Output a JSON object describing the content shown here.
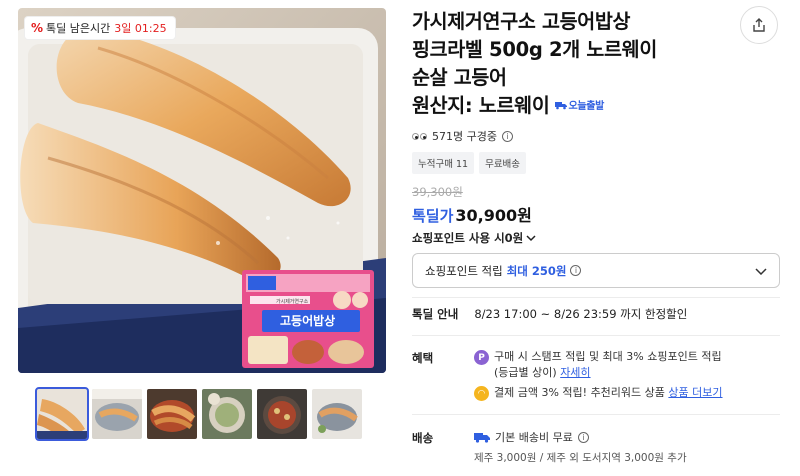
{
  "deal_badge": {
    "percent_icon": "%",
    "label": "톡딜 남은시간",
    "time": "3일 01:25"
  },
  "product": {
    "title_line1": "가시제거연구소 고등어밥상",
    "title_line2": "핑크라벨 500g 2개 노르웨이",
    "title_line3": "순살 고등어",
    "title_line4": "원산지: 노르웨이",
    "today_ship_label": "오늘출발"
  },
  "viewers": {
    "text": "571명 구경중"
  },
  "chips": [
    "누적구매 11",
    "무료배송"
  ],
  "price": {
    "original": "39,300원",
    "label": "톡딜가",
    "value": "30,900원"
  },
  "points": {
    "use_label": "쇼핑포인트 사용 시0원",
    "earn_label": "쇼핑포인트 적립",
    "earn_accent": "최대 250원"
  },
  "deal_info": {
    "key": "톡딜 안내",
    "value": "8/23 17:00 ~ 8/26 23:59 까지 한정할인"
  },
  "benefits": {
    "label": "혜택",
    "item1_line1": "구매 시 스탬프 적립 및 최대 3% 쇼핑포인트 적립",
    "item1_line2": "(등급별 상이)",
    "item1_link": "자세히",
    "item2_text": "결제 금액 3% 적립! 추천리워드 상품",
    "item2_link": "상품 더보기"
  },
  "shipping": {
    "label": "배송",
    "text": "기본 배송비 무료",
    "sub": "제주 3,000원 / 제주 외 도서지역 3,000원 추가"
  },
  "package_text": {
    "brand": "가시제거연구소",
    "name": "고등어밥상"
  },
  "colors": {
    "accent": "#2f5fe0",
    "deal_red": "#e32020",
    "package_pink": "#e84f8c"
  }
}
